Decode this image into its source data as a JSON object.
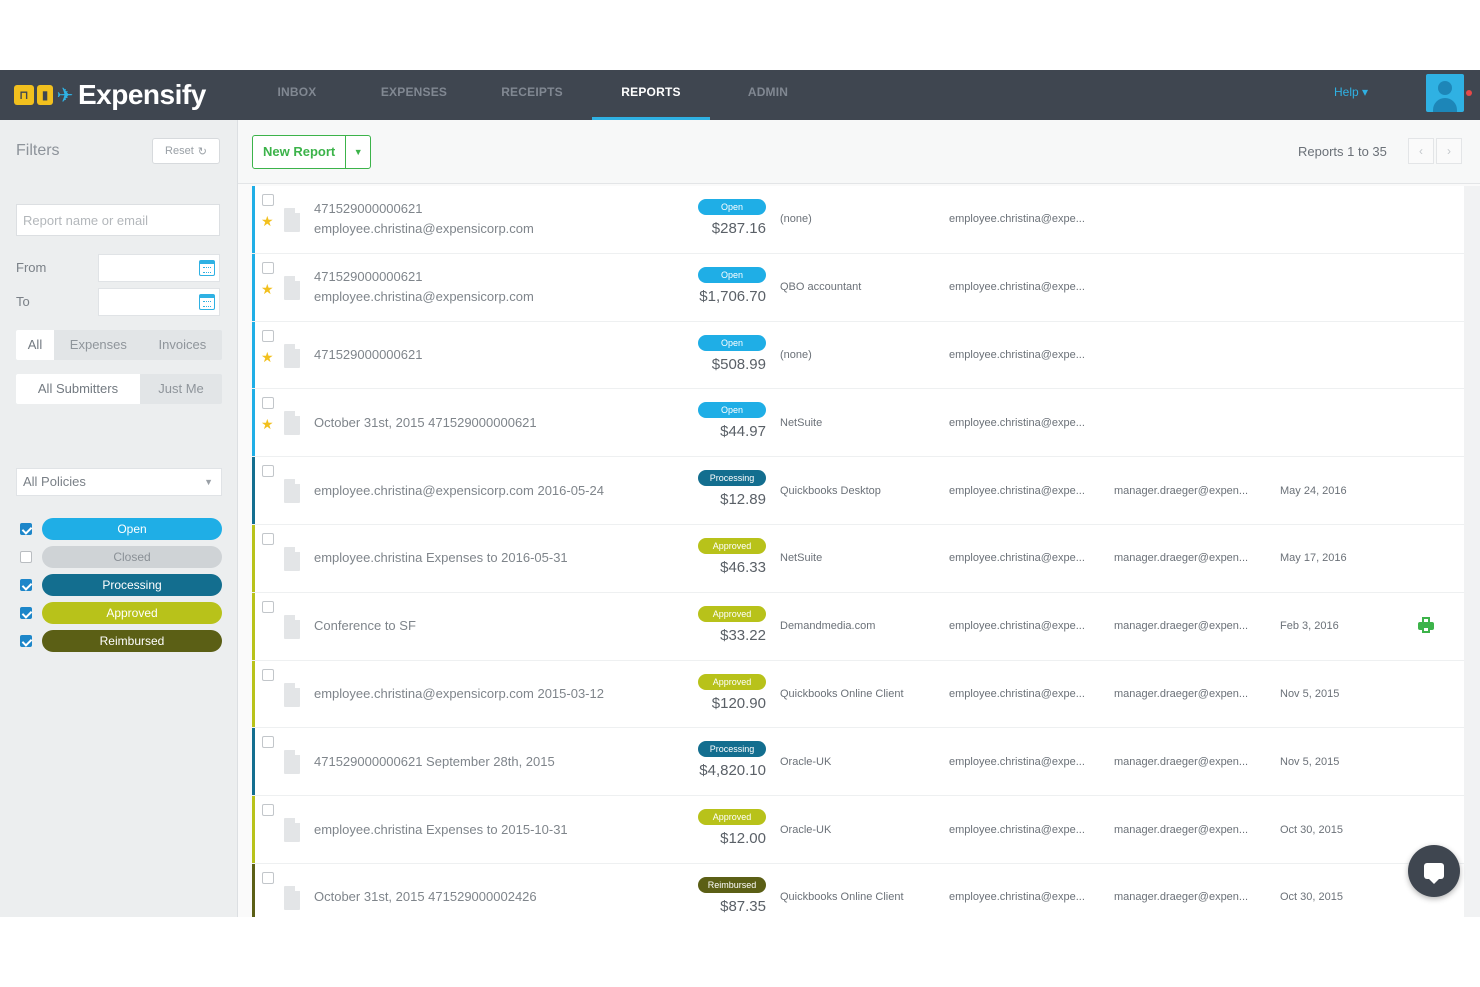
{
  "colors": {
    "nav_bg": "#3f4650",
    "accent": "#2fb1e3",
    "green": "#3cb34a",
    "open": "#1faee6",
    "closed": "#cfd3d6",
    "processing": "#136e8f",
    "approved": "#b8c21a",
    "reimbursed": "#5b5f15"
  },
  "nav": {
    "brand": "Expensify",
    "tabs": [
      "INBOX",
      "EXPENSES",
      "RECEIPTS",
      "REPORTS",
      "ADMIN"
    ],
    "active_tab": "REPORTS",
    "help": "Help ▾"
  },
  "sidebar": {
    "title": "Filters",
    "reset": "Reset",
    "search_placeholder": "Report name or email",
    "from_label": "From",
    "to_label": "To",
    "type_tabs": [
      "All",
      "Expenses",
      "Invoices"
    ],
    "submitter_tabs": [
      "All Submitters",
      "Just Me"
    ],
    "policies_select": "All Policies",
    "statuses": [
      {
        "label": "Open",
        "checked": true,
        "color": "#1faee6"
      },
      {
        "label": "Closed",
        "checked": false,
        "color": "#cfd3d6"
      },
      {
        "label": "Processing",
        "checked": true,
        "color": "#136e8f"
      },
      {
        "label": "Approved",
        "checked": true,
        "color": "#b8c21a"
      },
      {
        "label": "Reimbursed",
        "checked": true,
        "color": "#5b5f15"
      }
    ]
  },
  "toolbar": {
    "new_report": "New Report",
    "pagination": "Reports 1 to 35"
  },
  "reports": [
    {
      "title": "471529000000621\nemployee.christina@expensicorp.com",
      "status": "Open",
      "amount": "$287.16",
      "policy": "(none)",
      "submitter": "employee.christina@expe...",
      "approver": "",
      "date": "",
      "starred": true,
      "printed": false
    },
    {
      "title": "471529000000621\nemployee.christina@expensicorp.com",
      "status": "Open",
      "amount": "$1,706.70",
      "policy": "QBO accountant",
      "submitter": "employee.christina@expe...",
      "approver": "",
      "date": "",
      "starred": true,
      "printed": false
    },
    {
      "title": "471529000000621",
      "status": "Open",
      "amount": "$508.99",
      "policy": "(none)",
      "submitter": "employee.christina@expe...",
      "approver": "",
      "date": "",
      "starred": true,
      "printed": false
    },
    {
      "title": "October 31st, 2015 471529000000621",
      "status": "Open",
      "amount": "$44.97",
      "policy": "NetSuite",
      "submitter": "employee.christina@expe...",
      "approver": "",
      "date": "",
      "starred": true,
      "printed": false
    },
    {
      "title": "employee.christina@expensicorp.com 2016-05-24",
      "status": "Processing",
      "amount": "$12.89",
      "policy": "Quickbooks Desktop",
      "submitter": "employee.christina@expe...",
      "approver": "manager.draeger@expen...",
      "date": "May 24, 2016",
      "starred": false,
      "printed": false
    },
    {
      "title": "employee.christina Expenses to 2016-05-31",
      "status": "Approved",
      "amount": "$46.33",
      "policy": "NetSuite",
      "submitter": "employee.christina@expe...",
      "approver": "manager.draeger@expen...",
      "date": "May 17, 2016",
      "starred": false,
      "printed": false
    },
    {
      "title": "Conference to SF",
      "status": "Approved",
      "amount": "$33.22",
      "policy": "Demandmedia.com",
      "submitter": "employee.christina@expe...",
      "approver": "manager.draeger@expen...",
      "date": "Feb 3, 2016",
      "starred": false,
      "printed": true
    },
    {
      "title": "employee.christina@expensicorp.com 2015-03-12",
      "status": "Approved",
      "amount": "$120.90",
      "policy": "Quickbooks Online Client",
      "submitter": "employee.christina@expe...",
      "approver": "manager.draeger@expen...",
      "date": "Nov 5, 2015",
      "starred": false,
      "printed": false
    },
    {
      "title": "471529000000621 September 28th, 2015",
      "status": "Processing",
      "amount": "$4,820.10",
      "policy": "Oracle-UK",
      "submitter": "employee.christina@expe...",
      "approver": "manager.draeger@expen...",
      "date": "Nov 5, 2015",
      "starred": false,
      "printed": false
    },
    {
      "title": "employee.christina Expenses to 2015-10-31",
      "status": "Approved",
      "amount": "$12.00",
      "policy": "Oracle-UK",
      "submitter": "employee.christina@expe...",
      "approver": "manager.draeger@expen...",
      "date": "Oct 30, 2015",
      "starred": false,
      "printed": false
    },
    {
      "title": "October 31st, 2015 471529000002426",
      "status": "Reimbursed",
      "amount": "$87.35",
      "policy": "Quickbooks Online Client",
      "submitter": "employee.christina@expe...",
      "approver": "manager.draeger@expen...",
      "date": "Oct 30, 2015",
      "starred": false,
      "printed": false
    }
  ]
}
